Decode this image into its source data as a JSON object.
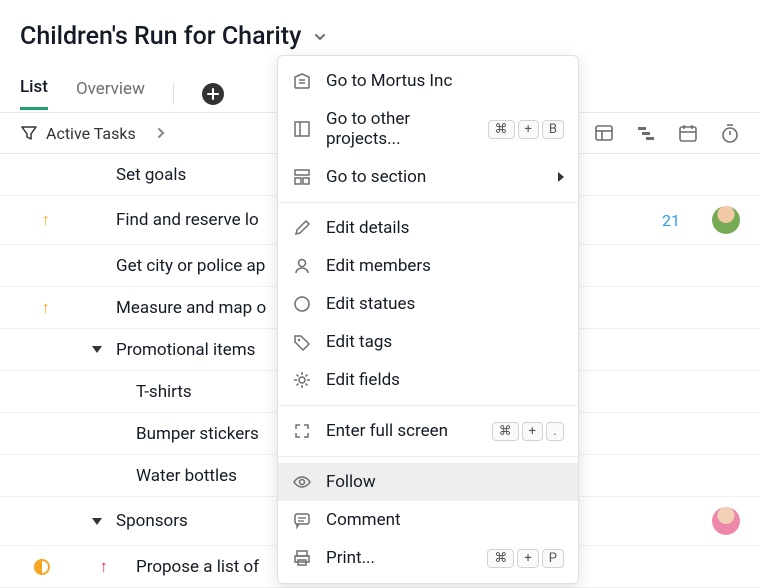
{
  "title": "Children's Run for Charity",
  "tabs": {
    "list": "List",
    "overview": "Overview"
  },
  "filter": {
    "label": "Active Tasks"
  },
  "tasks": [
    {
      "name": "Set goals",
      "indicator": null,
      "indent": false,
      "collapse": false
    },
    {
      "name": "Find and reserve lo",
      "indicator": "up",
      "indent": false,
      "collapse": false,
      "date": "21",
      "avatar": "male"
    },
    {
      "name": "Get city or police ap",
      "indicator": null,
      "indent": false,
      "collapse": false
    },
    {
      "name": "Measure and map o",
      "indicator": "up",
      "indent": false,
      "collapse": false
    },
    {
      "name": "Promotional items",
      "indicator": null,
      "indent": false,
      "collapse": true
    },
    {
      "name": "T-shirts",
      "indicator": null,
      "indent": true,
      "collapse": false
    },
    {
      "name": "Bumper stickers",
      "indicator": null,
      "indent": true,
      "collapse": false
    },
    {
      "name": "Water bottles",
      "indicator": null,
      "indent": true,
      "collapse": false
    },
    {
      "name": "Sponsors",
      "indicator": null,
      "indent": false,
      "collapse": true,
      "avatar": "female"
    },
    {
      "name": "Propose a list of",
      "indicator": "half-up-red",
      "indent": true,
      "collapse": false
    }
  ],
  "menu": {
    "org": "Go to Mortus Inc",
    "other_projects": "Go to other projects...",
    "section": "Go to section",
    "edit_details": "Edit details",
    "edit_members": "Edit members",
    "edit_statuses": "Edit statues",
    "edit_tags": "Edit tags",
    "edit_fields": "Edit fields",
    "fullscreen": "Enter full screen",
    "follow": "Follow",
    "comment": "Comment",
    "print": "Print..."
  },
  "kbd": {
    "cmd": "⌘",
    "plus": "+",
    "B": "B",
    "dot": ".",
    "P": "P"
  }
}
